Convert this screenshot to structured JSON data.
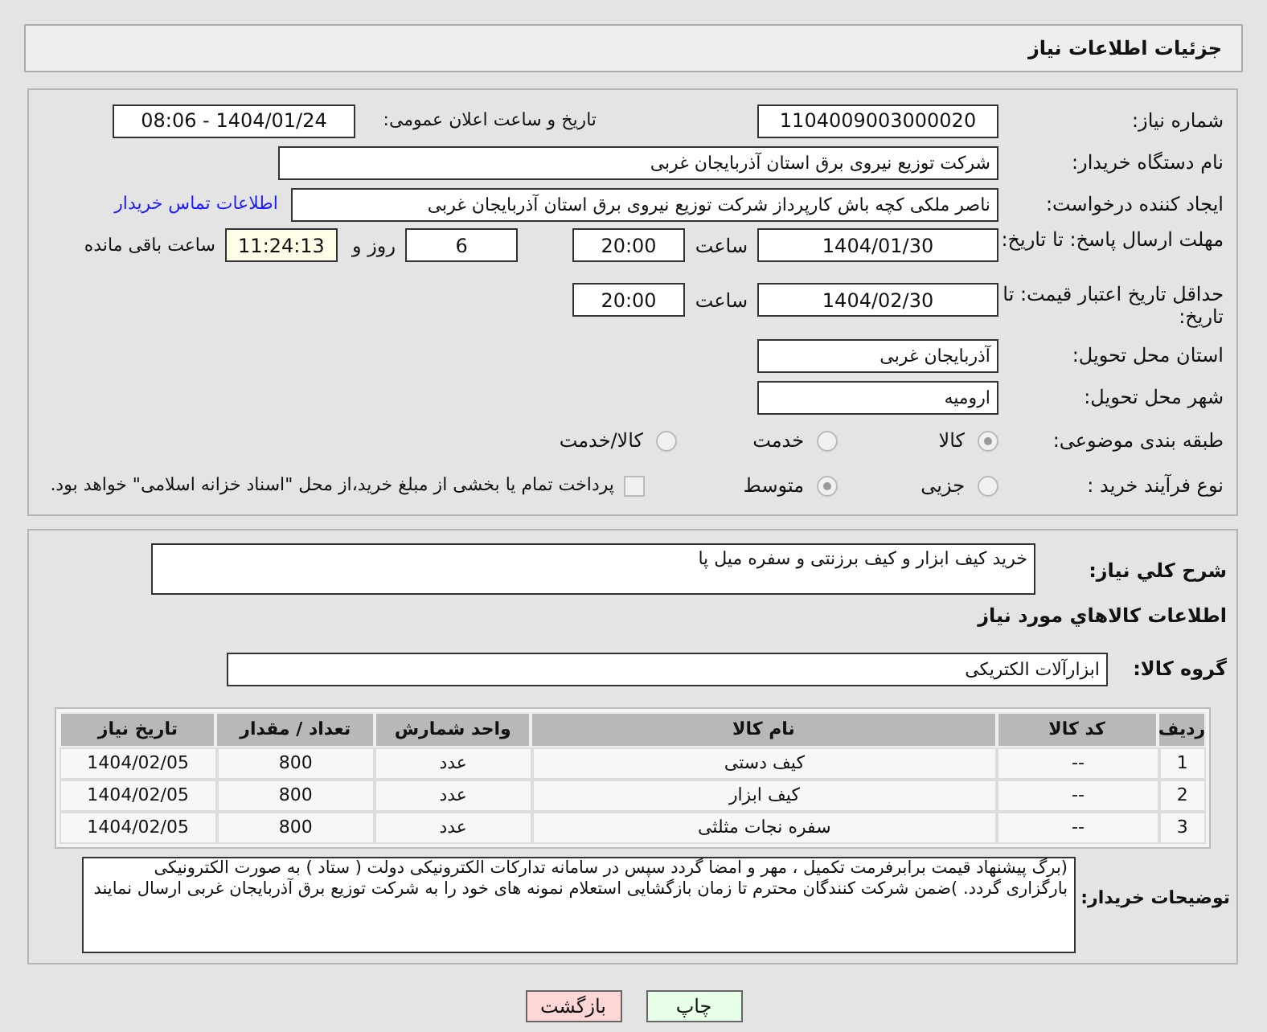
{
  "header": {
    "title": "جزئیات اطلاعات نیاز"
  },
  "need_number": {
    "label": "شماره نیاز:",
    "value": "1104009003000020"
  },
  "announcement": {
    "label": "تاریخ و ساعت اعلان عمومی:",
    "value": "1404/01/24 - 08:06"
  },
  "buyer_org": {
    "label": "نام دستگاه خریدار:",
    "value": "شرکت توزیع نیروی برق استان آذربایجان غربی"
  },
  "requester": {
    "label": "ایجاد کننده درخواست:",
    "value": "ناصر ملکی کچه باش کارپرداز شرکت توزیع نیروی برق استان آذربایجان غربی",
    "link": "اطلاعات تماس خریدار"
  },
  "reply_deadline": {
    "label": "مهلت ارسال پاسخ: تا تاریخ:",
    "date": "1404/01/30",
    "time_label": "ساعت",
    "time": "20:00",
    "days": "6",
    "days_label": "روز و",
    "remaining": "11:24:13",
    "remaining_label": "ساعت باقی مانده"
  },
  "price_validity": {
    "label": "حداقل تاریخ اعتبار قیمت: تا تاریخ:",
    "date": "1404/02/30",
    "time_label": "ساعت",
    "time": "20:00"
  },
  "province": {
    "label": "استان محل تحویل:",
    "value": "آذربایجان غربی"
  },
  "city": {
    "label": "شهر محل تحویل:",
    "value": "ارومیه"
  },
  "category": {
    "label": "طبقه بندی موضوعی:",
    "options": [
      {
        "label": "کالا",
        "selected": true
      },
      {
        "label": "خدمت",
        "selected": false
      },
      {
        "label": "کالا/خدمت",
        "selected": false
      }
    ]
  },
  "purchase_process": {
    "label": "نوع فرآیند خرید :",
    "options": [
      {
        "label": "جزیی",
        "selected": false
      },
      {
        "label": "متوسط",
        "selected": true
      }
    ],
    "treasury": {
      "checked": false,
      "text": "پرداخت تمام یا بخشی از مبلغ خرید،از محل \"اسناد خزانه اسلامی\" خواهد بود."
    }
  },
  "description": {
    "label": "شرح کلي نياز:",
    "value": "خرید کیف ابزار و کیف برزنتی و سفره میل پا"
  },
  "goods_section_title": "اطلاعات کالاهاي مورد نياز",
  "goods_group": {
    "label": "گروه کالا:",
    "value": "ابزارآلات الکتریکی"
  },
  "table": {
    "columns": [
      "ردیف",
      "کد کالا",
      "نام کالا",
      "واحد شمارش",
      "تعداد / مقدار",
      "تاریخ نیاز"
    ],
    "rows": [
      [
        "1",
        "--",
        "کیف دستی",
        "عدد",
        "800",
        "1404/02/05"
      ],
      [
        "2",
        "--",
        "کیف ابزار",
        "عدد",
        "800",
        "1404/02/05"
      ],
      [
        "3",
        "--",
        "سفره نجات مثلثی",
        "عدد",
        "800",
        "1404/02/05"
      ]
    ]
  },
  "buyer_notes": {
    "label": "توضیحات خریدار:",
    "value": "(برگ پیشنهاد قیمت برابرفرمت تکمیل ، مهر و امضا گردد سپس در سامانه تداركات الكترونيكی دولت ( ستاد ) به صورت الکترونیکی  بارگزاری گردد. )ضمن شرکت کنندگان محترم تا زمان بازگشایی استعلام نمونه های خود را به شرکت توزیع برق آذربایجان غربی ارسال نمایند"
  },
  "buttons": [
    {
      "label": "چاپ",
      "kind": "print"
    },
    {
      "label": "بازگشت",
      "kind": "back"
    }
  ]
}
